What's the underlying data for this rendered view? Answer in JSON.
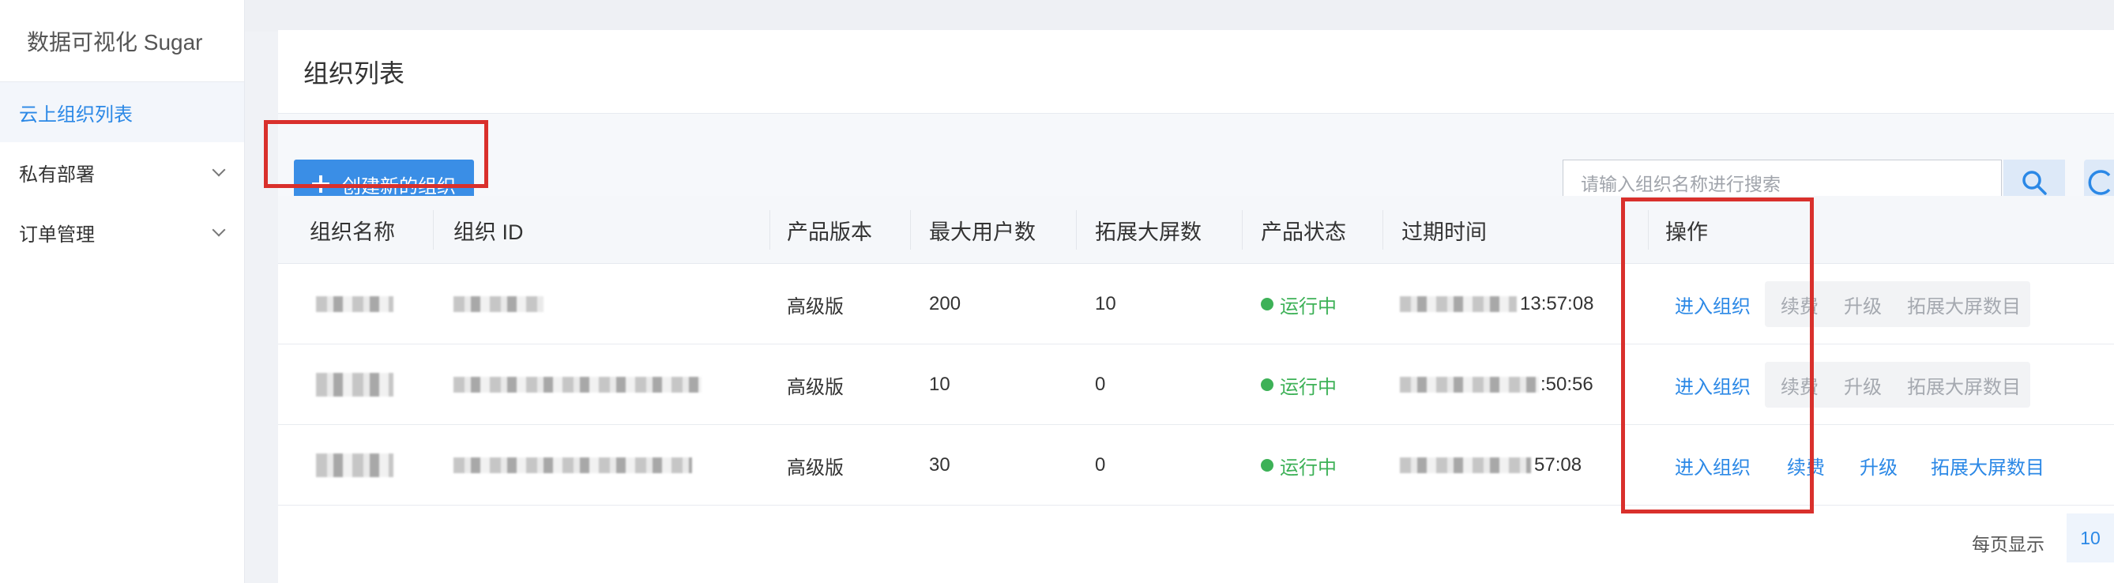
{
  "app": {
    "brand": "数据可视化 Sugar"
  },
  "sidebar": {
    "items": [
      {
        "label": "云上组织列表",
        "active": true
      },
      {
        "label": "私有部署",
        "expandable": true
      },
      {
        "label": "订单管理",
        "expandable": true
      }
    ]
  },
  "page": {
    "title": "组织列表"
  },
  "toolbar": {
    "create_label": "创建新的组织",
    "search_placeholder": "请输入组织名称进行搜索"
  },
  "table": {
    "headers": [
      "组织名称",
      "组织 ID",
      "产品版本",
      "最大用户数",
      "拓展大屏数",
      "产品状态",
      "过期时间",
      "操作"
    ],
    "rows": [
      {
        "version": "高级版",
        "max_users": "200",
        "screens": "10",
        "status": "运行中",
        "expire_suffix": "13:57:08",
        "ops_enabled": false
      },
      {
        "version": "高级版",
        "max_users": "10",
        "screens": "0",
        "status": "运行中",
        "expire_suffix": ":50:56",
        "ops_enabled": false
      },
      {
        "version": "高级版",
        "max_users": "30",
        "screens": "0",
        "status": "运行中",
        "expire_suffix": "57:08",
        "ops_enabled": true
      }
    ],
    "ops": {
      "enter": "进入组织",
      "renew": "续费",
      "upgrade": "升级",
      "expand": "拓展大屏数目"
    }
  },
  "pagination": {
    "label": "每页显示",
    "page_size": "10"
  },
  "colors": {
    "primary": "#3a8ee6",
    "link": "#2b88e6",
    "success": "#3db157",
    "highlight": "#d9302c"
  },
  "icons": [
    "plus-icon",
    "search-icon",
    "chevron-down-icon",
    "status-dot-icon"
  ]
}
